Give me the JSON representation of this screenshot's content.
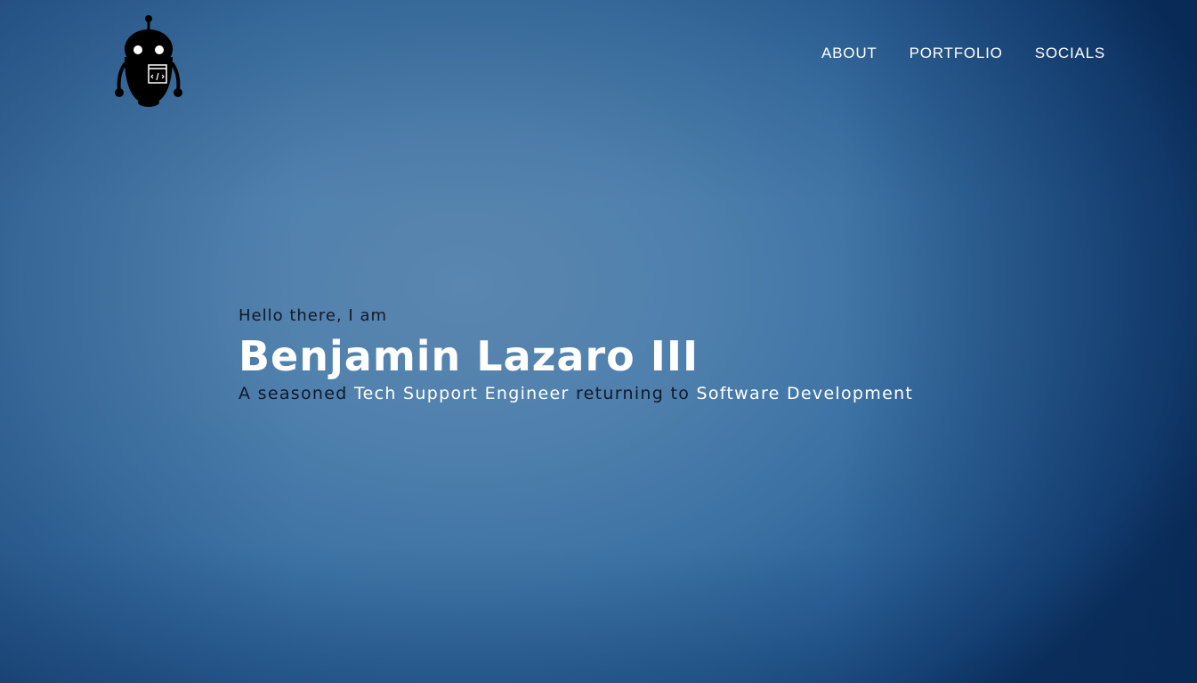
{
  "nav": {
    "logo_icon": "robot-coder-icon",
    "links": [
      {
        "label": "ABOUT"
      },
      {
        "label": "PORTFOLIO"
      },
      {
        "label": "SOCIALS"
      }
    ]
  },
  "hero": {
    "greeting": "Hello there, I am",
    "name": "Benjamin Lazaro III",
    "tagline": {
      "part1": "A seasoned ",
      "role_current": "Tech Support Engineer",
      "part2": " returning to ",
      "role_target": "Software Development"
    }
  },
  "colors": {
    "accent_text": "#ffffff",
    "body_text": "#111827",
    "background_center": "#5a86b0",
    "background_edge": "#0c3566"
  }
}
